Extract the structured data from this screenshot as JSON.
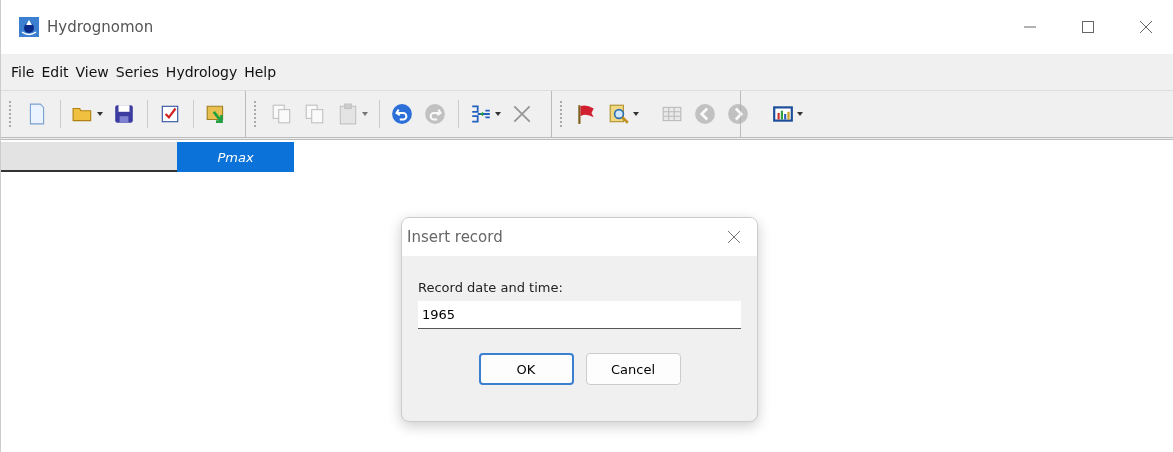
{
  "window": {
    "title": "Hydrognomon"
  },
  "menu": [
    "File",
    "Edit",
    "View",
    "Series",
    "Hydrology",
    "Help"
  ],
  "toolbar": [
    [
      {
        "kind": "new",
        "dropdown": false,
        "disabled": false
      }
    ],
    [
      {
        "kind": "open",
        "dropdown": true,
        "disabled": false
      },
      {
        "kind": "save",
        "dropdown": false,
        "disabled": false
      }
    ],
    [
      {
        "kind": "check",
        "dropdown": false,
        "disabled": false
      }
    ],
    [
      {
        "kind": "import",
        "dropdown": false,
        "disabled": false
      }
    ],
    [
      {
        "kind": "copy",
        "dropdown": false,
        "disabled": true
      },
      {
        "kind": "copy",
        "dropdown": false,
        "disabled": true
      },
      {
        "kind": "paste",
        "dropdown": true,
        "disabled": true
      }
    ],
    [
      {
        "kind": "undo",
        "dropdown": false,
        "disabled": false
      },
      {
        "kind": "redo",
        "dropdown": false,
        "disabled": true
      }
    ],
    [
      {
        "kind": "merge",
        "dropdown": true,
        "disabled": false
      },
      {
        "kind": "delete",
        "dropdown": false,
        "disabled": true
      }
    ],
    [
      {
        "kind": "flag",
        "dropdown": false,
        "disabled": false
      },
      {
        "kind": "find",
        "dropdown": true,
        "disabled": false
      }
    ],
    [
      {
        "kind": "table",
        "dropdown": false,
        "disabled": true
      },
      {
        "kind": "back",
        "dropdown": false,
        "disabled": true
      },
      {
        "kind": "forward",
        "dropdown": false,
        "disabled": true
      }
    ],
    [
      {
        "kind": "chart",
        "dropdown": true,
        "disabled": false
      }
    ]
  ],
  "grid": {
    "columns": [
      {
        "label": "Pmax",
        "selected": true
      }
    ]
  },
  "dialog": {
    "title": "Insert record",
    "label": "Record date and time:",
    "value": "1965",
    "buttons": [
      {
        "label": "OK",
        "default": true
      },
      {
        "label": "Cancel",
        "default": false
      }
    ]
  }
}
